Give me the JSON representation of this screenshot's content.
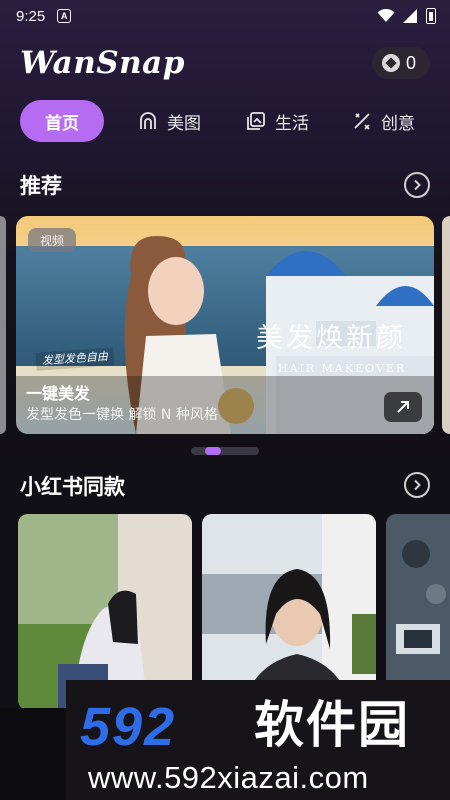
{
  "status_bar": {
    "time": "9:25",
    "notif_glyph": "A"
  },
  "header": {
    "app_name": "WanSnap",
    "coin_count": "0"
  },
  "tabs": [
    {
      "label": "首页",
      "icon": "none",
      "active": true
    },
    {
      "label": "美图",
      "icon": "portrait-icon",
      "active": false
    },
    {
      "label": "生活",
      "icon": "photo-stack-icon",
      "active": false
    },
    {
      "label": "创意",
      "icon": "magic-wand-icon",
      "active": false
    }
  ],
  "recommend": {
    "title": "推荐",
    "banner": {
      "badge": "视频",
      "overlay_title": "美发焕新颜",
      "overlay_subtitle": "HAIR MAKEOVER",
      "tag": "发型发色自由",
      "title": "一键美发",
      "desc": "发型发色一键换 解锁 N 种风格"
    },
    "carousel_active_index": 1
  },
  "xhs": {
    "title": "小红书同款"
  },
  "watermark": {
    "logo_num": "592",
    "logo_cn": "软件园",
    "url": "www.592xiazai.com"
  },
  "colors": {
    "accent": "#b56cf2",
    "background": "#111016",
    "watermark_blue": "#2f6de8"
  }
}
